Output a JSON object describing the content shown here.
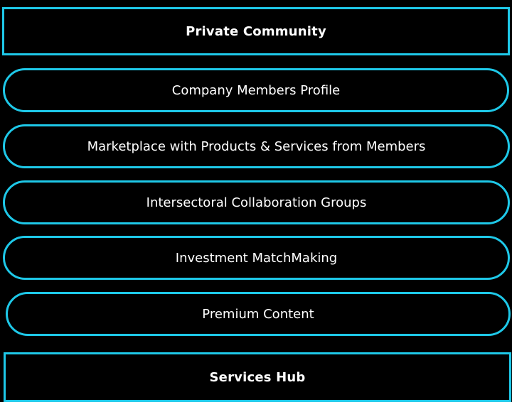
{
  "colors": {
    "background": "#000000",
    "accent_border": "#1ec8e8",
    "text": "#ffffff"
  },
  "header": {
    "title": "Private Community"
  },
  "features": [
    {
      "label": "Company Members Profile"
    },
    {
      "label": "Marketplace with Products & Services from Members"
    },
    {
      "label": "Intersectoral Collaboration Groups"
    },
    {
      "label": "Investment MatchMaking"
    },
    {
      "label": "Premium Content"
    }
  ],
  "footer_section": {
    "title": "Services Hub"
  }
}
